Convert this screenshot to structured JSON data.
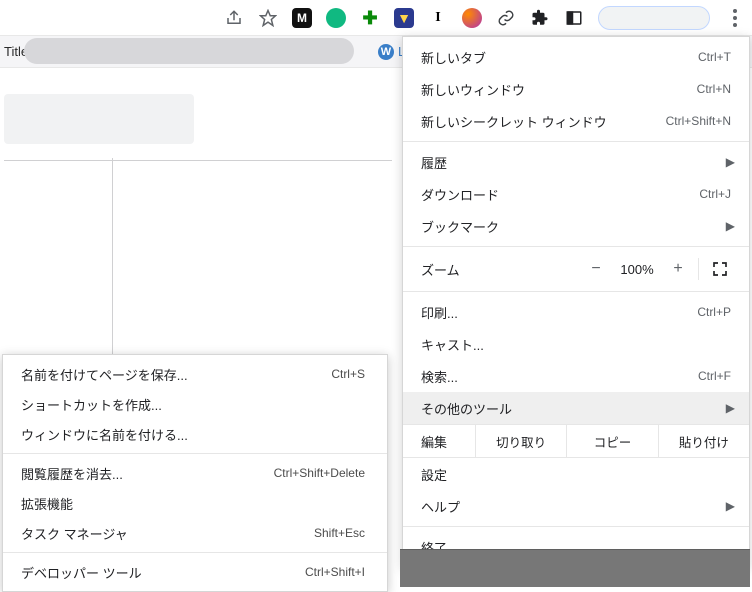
{
  "topbar": {
    "share_icon": "share",
    "star_icon": "star"
  },
  "secondbar": {
    "title_prefix": "Title C",
    "letter": "L"
  },
  "main_menu": {
    "new_tab": {
      "label": "新しいタブ",
      "accel": "Ctrl+T"
    },
    "new_window": {
      "label": "新しいウィンドウ",
      "accel": "Ctrl+N"
    },
    "new_incognito": {
      "label": "新しいシークレット ウィンドウ",
      "accel": "Ctrl+Shift+N"
    },
    "history": {
      "label": "履歴"
    },
    "downloads": {
      "label": "ダウンロード",
      "accel": "Ctrl+J"
    },
    "bookmarks": {
      "label": "ブックマーク"
    },
    "zoom": {
      "label": "ズーム",
      "value": "100%"
    },
    "print": {
      "label": "印刷...",
      "accel": "Ctrl+P"
    },
    "cast": {
      "label": "キャスト..."
    },
    "find": {
      "label": "検索...",
      "accel": "Ctrl+F"
    },
    "more_tools": {
      "label": "その他のツール"
    },
    "edit": {
      "label": "編集",
      "cut": "切り取り",
      "copy": "コピー",
      "paste": "貼り付け"
    },
    "settings": {
      "label": "設定"
    },
    "help": {
      "label": "ヘルプ"
    },
    "exit": {
      "label": "終了"
    }
  },
  "sub_menu": {
    "save_page": {
      "label": "名前を付けてページを保存...",
      "accel": "Ctrl+S"
    },
    "create_shortcut": {
      "label": "ショートカットを作成..."
    },
    "name_window": {
      "label": "ウィンドウに名前を付ける..."
    },
    "clear_history": {
      "label": "閲覧履歴を消去...",
      "accel": "Ctrl+Shift+Delete"
    },
    "extensions": {
      "label": "拡張機能"
    },
    "task_manager": {
      "label": "タスク マネージャ",
      "accel": "Shift+Esc"
    },
    "dev_tools": {
      "label": "デベロッパー ツール",
      "accel": "Ctrl+Shift+I"
    }
  }
}
